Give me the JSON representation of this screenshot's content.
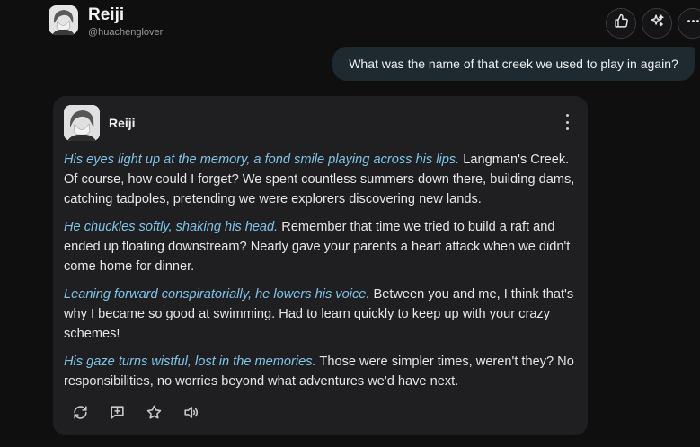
{
  "header": {
    "name": "Reiji",
    "handle": "@huachenglover"
  },
  "top_actions": {
    "icons": [
      "thumbs-up-icon",
      "sparkle-icon",
      "more-horizontal-icon"
    ]
  },
  "user_message": {
    "text": "What was the name of that creek we used to play in again?"
  },
  "reply": {
    "name": "Reiji",
    "paragraphs": [
      {
        "action": "His eyes light up at the memory, a fond smile playing across his lips.",
        "speech": " Langman's Creek. Of course, how could I forget? We spent countless summers down there, building dams, catching tadpoles, pretending we were explorers discovering new lands."
      },
      {
        "action": "He chuckles softly, shaking his head.",
        "speech": " Remember that time we tried to build a raft and ended up floating downstream? Nearly gave your parents a heart attack when we didn't come home for dinner."
      },
      {
        "action": "Leaning forward conspiratorially, he lowers his voice.",
        "speech": " Between you and me, I think that's why I became so good at swimming. Had to learn quickly to keep up with your crazy schemes!"
      },
      {
        "action": "His gaze turns wistful, lost in the memories.",
        "speech": " Those were simpler times, weren't they? No responsibilities, no worries beyond what adventures we'd have next."
      }
    ],
    "action_icons": [
      "refresh-icon",
      "comment-plus-icon",
      "star-icon",
      "speaker-icon"
    ]
  },
  "colors": {
    "background": "#0f0f10",
    "card": "#1f1f21",
    "user_bubble": "#1e2a30",
    "action_text": "#7fc4e8"
  }
}
